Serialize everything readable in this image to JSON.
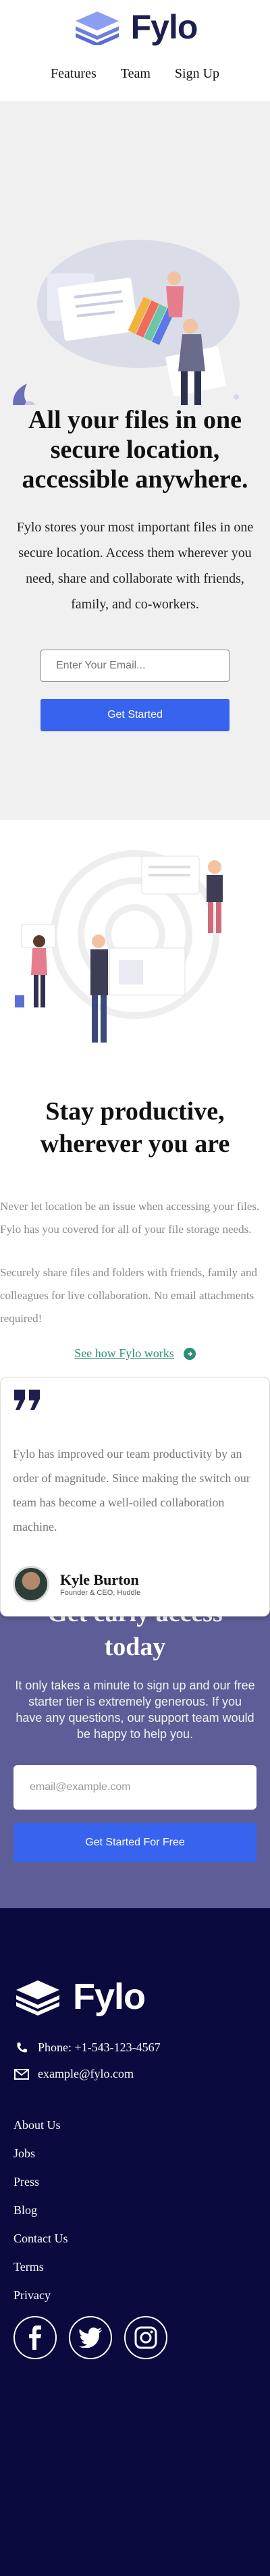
{
  "brand": {
    "name": "Fylo"
  },
  "nav": {
    "items": [
      "Features",
      "Team",
      "Sign Up"
    ]
  },
  "hero": {
    "title": "All your files in one secure location, accessible anywhere.",
    "body": "Fylo stores your most important files in one secure location. Access them wherever you need, share and collaborate with friends, family, and co-workers.",
    "email_placeholder": "Enter Your Email...",
    "cta": "Get Started"
  },
  "productive": {
    "title": "Stay productive, wherever you are",
    "p1": "Never let location be an issue when accessing your files. Fylo has you covered for all of your file storage needs.",
    "p2": "Securely share files and folders with friends, family and colleagues for live collaboration. No email attachments required!",
    "link": "See how Fylo works"
  },
  "testimonial": {
    "quote": "Fylo has improved our team productivity by an order of magnitude. Since making the switch our team has become a well-oiled collaboration machine.",
    "name": "Kyle Burton",
    "role": "Founder & CEO, Huddle"
  },
  "early": {
    "title": "Get early access today",
    "body": "It only takes a minute to sign up and our free starter tier is extremely generous. If you have any questions, our support team would be happy to help you.",
    "email_placeholder": "email@example.com",
    "cta": "Get Started For Free"
  },
  "footer": {
    "phone": "Phone: +1-543-123-4567",
    "email": "example@fylo.com",
    "links": [
      "About Us",
      "Jobs",
      "Press",
      "Blog",
      "Contact Us",
      "Terms",
      "Privacy"
    ],
    "social": [
      "facebook-icon",
      "twitter-icon",
      "instagram-icon"
    ]
  },
  "colors": {
    "accent": "#3863ef",
    "dark_navy": "#0a0a3e",
    "purple": "#5d5e97",
    "link_green": "#2d8d76"
  }
}
